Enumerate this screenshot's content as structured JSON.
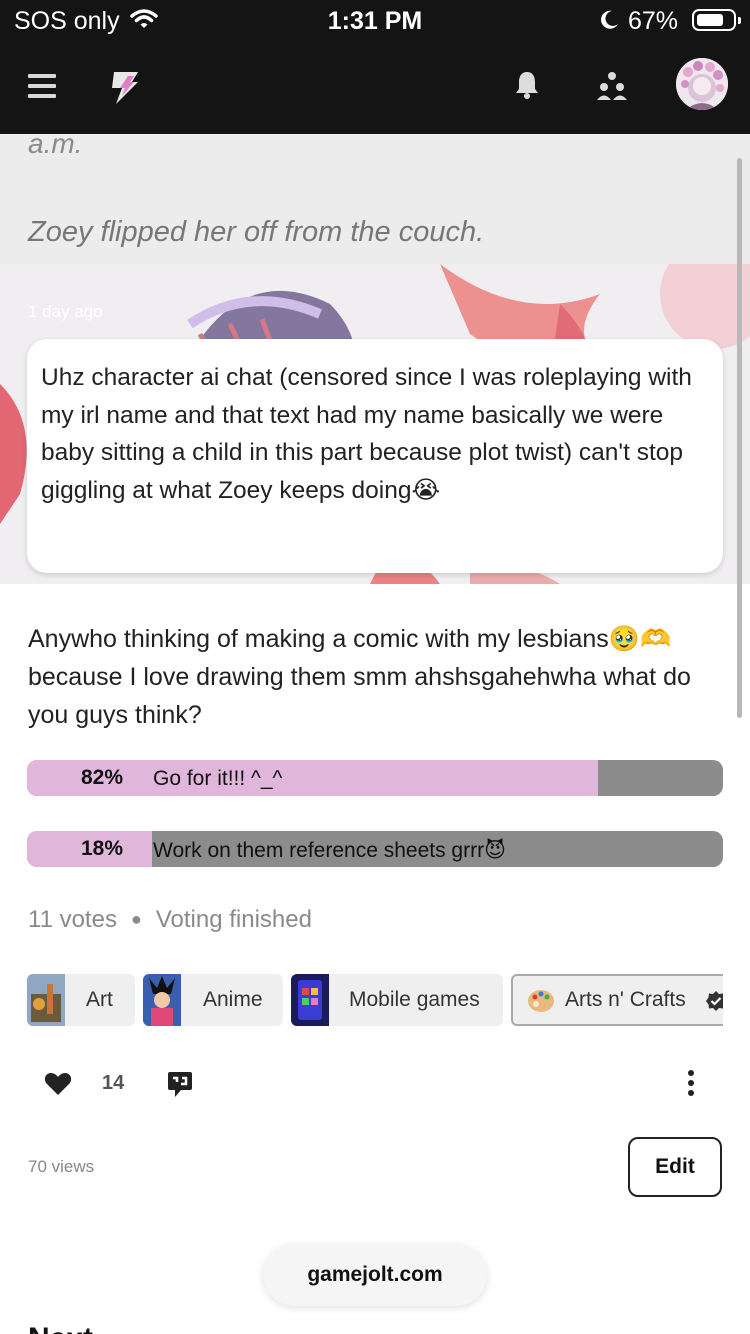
{
  "status_bar": {
    "carrier": "SOS only",
    "time": "1:31 PM",
    "battery": "67%"
  },
  "nav": {
    "icons": [
      "menu-icon",
      "gamejolt-logo-icon",
      "bell-icon",
      "friends-icon",
      "avatar"
    ]
  },
  "post": {
    "prev_text_fragment": "a.m.",
    "prev_italic_line": "Zoey flipped her off from the couch.",
    "time_ago": "1 day ago",
    "caption": "Uhz character ai chat (censored since I was roleplaying with my irl name and that text had my name basically we were baby sitting a child in this part because plot twist) can't stop giggling at what Zoey keeps doing😭",
    "body": "Anywho thinking of making a comic with my lesbians🥹🫶 because I love drawing them smm ahshsgahehwha what do you guys think?",
    "poll": {
      "options": [
        {
          "percent_label": "82%",
          "percent": 82,
          "label": "Go for it!!! ^_^"
        },
        {
          "percent_label": "18%",
          "percent": 18,
          "label": "Work on them reference sheets grrr😈"
        }
      ],
      "votes": "11 votes",
      "status": "Voting finished"
    },
    "communities": [
      "Art",
      "Anime",
      "Mobile games",
      "Arts n' Crafts"
    ],
    "likes": "14",
    "views": "70 views",
    "edit_label": "Edit"
  },
  "url_bar": "gamejolt.com",
  "next_heading": "Next",
  "colors": {
    "nav_bg": "#141414",
    "poll_fill": "#e0b7da",
    "poll_bg": "#8c8c8c"
  }
}
